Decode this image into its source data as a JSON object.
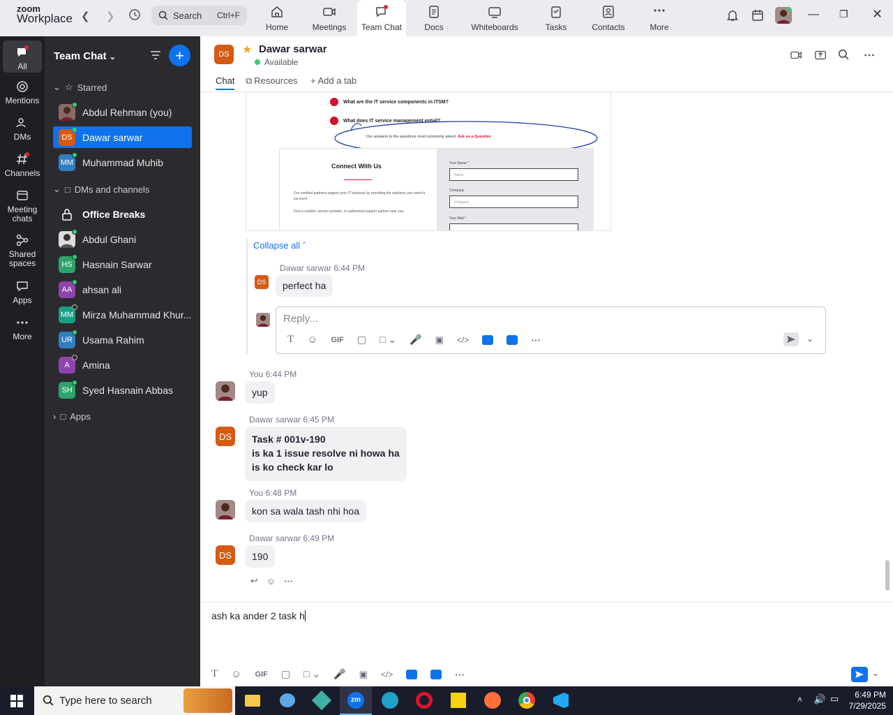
{
  "app": {
    "logo_top": "zoom",
    "logo_bottom": "Workplace"
  },
  "search": {
    "label": "Search",
    "shortcut": "Ctrl+F"
  },
  "nav": {
    "tabs": [
      {
        "label": "Home",
        "icon": "home-icon"
      },
      {
        "label": "Meetings",
        "icon": "video-icon"
      },
      {
        "label": "Team Chat",
        "icon": "chat-icon"
      },
      {
        "label": "Docs",
        "icon": "docs-icon"
      },
      {
        "label": "Whiteboards",
        "icon": "whiteboard-icon"
      },
      {
        "label": "Tasks",
        "icon": "tasks-icon"
      },
      {
        "label": "Contacts",
        "icon": "contacts-icon"
      },
      {
        "label": "More",
        "icon": "more-icon"
      }
    ]
  },
  "rail": {
    "items": [
      "All",
      "Mentions",
      "DMs",
      "Channels",
      "Meeting chats",
      "Shared spaces",
      "Apps",
      "More"
    ]
  },
  "sidebar": {
    "title": "Team Chat",
    "starred_label": "Starred",
    "starred": [
      {
        "name": "Abdul Rehman (you)",
        "initials": ""
      },
      {
        "name": "Dawar sarwar",
        "initials": "DS",
        "color": "#d55a12"
      },
      {
        "name": "Muhammad Muhib",
        "initials": "MM",
        "color": "#2f7fc1"
      }
    ],
    "dms_label": "DMs and channels",
    "dms": [
      {
        "name": "Office Breaks",
        "initials": ""
      },
      {
        "name": "Abdul Ghani",
        "initials": ""
      },
      {
        "name": "Hasnain Sarwar",
        "initials": "HS",
        "color": "#2ea36a"
      },
      {
        "name": "ahsan ali",
        "initials": "AA",
        "color": "#8e44ad"
      },
      {
        "name": "Mirza Muhammad Khur...",
        "initials": "MM",
        "color": "#16a085"
      },
      {
        "name": "Usama Rahim",
        "initials": "UR",
        "color": "#2f7fc1"
      },
      {
        "name": "Amina",
        "initials": "A",
        "color": "#8e44ad"
      },
      {
        "name": "Syed Hasnain Abbas",
        "initials": "SH",
        "color": "#2ea36a"
      }
    ],
    "apps_label": "Apps"
  },
  "chat": {
    "contact_initials": "DS",
    "contact_name": "Dawar sarwar",
    "contact_status": "Available",
    "tabs": [
      "Chat",
      "Resources",
      "Add a tab"
    ],
    "collapse_label": "Collapse all",
    "reply_placeholder": "Reply...",
    "gif_label": "GIF",
    "shot": {
      "q1": "What are the IT service components in ITSM?",
      "q2": "What does IT service management entail?",
      "note": "Our answers to the questions most commonly asked.",
      "note_link": "Ask us a Question",
      "connect_title": "Connect With Us",
      "connect_text1": "Our certified partners support your IT business by providing the solutions you need to succeed.",
      "connect_text2": "Find a reseller, service provider, or authorized support partner near you.",
      "field1": "Your Name *",
      "field1_ph": "Name",
      "field2": "Company",
      "field2_ph": "Company",
      "field3": "Your Mail *"
    },
    "messages": [
      {
        "sender": "Dawar sarwar",
        "time": "6:44 PM",
        "text": "perfect ha"
      },
      {
        "sender": "You",
        "time": "6:44 PM",
        "text": "yup"
      },
      {
        "sender": "Dawar sarwar",
        "time": "6:45 PM",
        "line1": "Task # 001v-190",
        "line2": "is ka 1 issue resolve ni howa ha",
        "line3": "is ko check kar lo"
      },
      {
        "sender": "You",
        "time": "6:48 PM",
        "text": "kon sa wala tash nhi hoa"
      },
      {
        "sender": "Dawar sarwar",
        "time": "6:49 PM",
        "text": "190"
      }
    ],
    "compose_text": "ash ka ander 2 task h"
  },
  "taskbar": {
    "search_placeholder": "Type here to search",
    "time": "6:49 PM",
    "date": "7/29/2025"
  },
  "colors": {
    "accent": "#0e72ed",
    "sidebar": "#2b2b2f",
    "rail": "#1f1f23"
  }
}
